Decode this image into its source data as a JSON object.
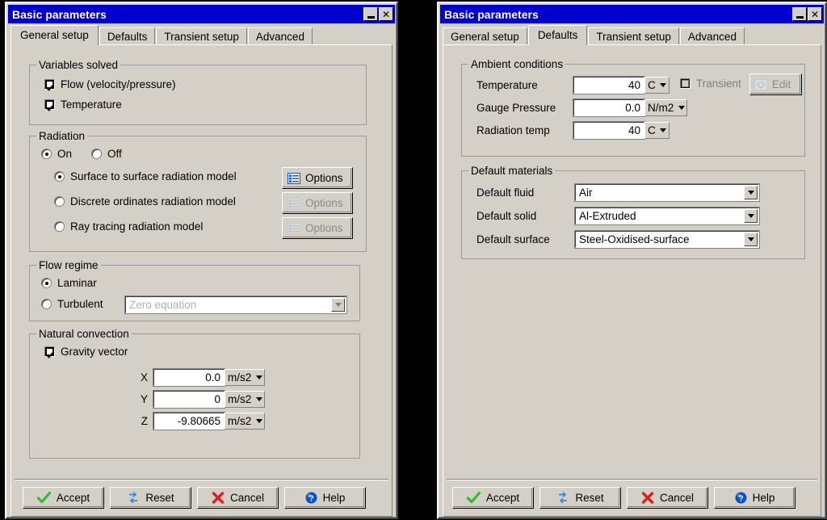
{
  "windows": [
    {
      "title": "Basic parameters",
      "titlebar": {
        "minimize": "minimize-icon",
        "close": "close-icon"
      },
      "tabs": [
        {
          "label": "General setup",
          "active": true
        },
        {
          "label": "Defaults",
          "active": false
        },
        {
          "label": "Transient setup",
          "active": false
        },
        {
          "label": "Advanced",
          "active": false
        }
      ],
      "groups": {
        "variables_solved": {
          "legend": "Variables solved",
          "checks": [
            {
              "label": "Flow (velocity/pressure)",
              "checked": true
            },
            {
              "label": "Temperature",
              "checked": true
            }
          ]
        },
        "radiation": {
          "legend": "Radiation",
          "onoff": [
            {
              "label": "On",
              "selected": true
            },
            {
              "label": "Off",
              "selected": false
            }
          ],
          "models": [
            {
              "label": "Surface to surface radiation model",
              "selected": true,
              "button": "Options",
              "enabled": true
            },
            {
              "label": "Discrete ordinates radiation model",
              "selected": false,
              "button": "Options",
              "enabled": false
            },
            {
              "label": "Ray tracing radiation model",
              "selected": false,
              "button": "Options",
              "enabled": false
            }
          ]
        },
        "flow_regime": {
          "legend": "Flow regime",
          "options": [
            {
              "label": "Laminar",
              "selected": true
            },
            {
              "label": "Turbulent",
              "selected": false
            }
          ],
          "turbulence_model": "Zero equation",
          "turbulence_enabled": false
        },
        "natural_convection": {
          "legend": "Natural convection",
          "gravity_label": "Gravity vector",
          "gravity_checked": true,
          "components": [
            {
              "axis": "X",
              "value": "0.0",
              "unit": "m/s2"
            },
            {
              "axis": "Y",
              "value": "0",
              "unit": "m/s2"
            },
            {
              "axis": "Z",
              "value": "-9.80665",
              "unit": "m/s2"
            }
          ]
        }
      },
      "buttons": [
        {
          "label": "Accept",
          "icon": "check-icon"
        },
        {
          "label": "Reset",
          "icon": "refresh-icon"
        },
        {
          "label": "Cancel",
          "icon": "cross-icon"
        },
        {
          "label": "Help",
          "icon": "question-icon"
        }
      ]
    },
    {
      "title": "Basic parameters",
      "titlebar": {
        "minimize": "minimize-icon",
        "close": "close-icon"
      },
      "tabs": [
        {
          "label": "General setup",
          "active": false
        },
        {
          "label": "Defaults",
          "active": true
        },
        {
          "label": "Transient setup",
          "active": false
        },
        {
          "label": "Advanced",
          "active": false
        }
      ],
      "groups": {
        "ambient_conditions": {
          "legend": "Ambient conditions",
          "rows": [
            {
              "label": "Temperature",
              "value": "40",
              "unit": "C"
            },
            {
              "label": "Gauge Pressure",
              "value": "0.0",
              "unit": "N/m2"
            },
            {
              "label": "Radiation temp",
              "value": "40",
              "unit": "C"
            }
          ],
          "transient_label": "Transient",
          "transient_checked": false,
          "transient_enabled": false,
          "edit_label": "Edit",
          "edit_enabled": false
        },
        "default_materials": {
          "legend": "Default materials",
          "rows": [
            {
              "label": "Default fluid",
              "value": "Air"
            },
            {
              "label": "Default solid",
              "value": "Al-Extruded"
            },
            {
              "label": "Default surface",
              "value": "Steel-Oxidised-surface"
            }
          ]
        }
      },
      "buttons": [
        {
          "label": "Accept",
          "icon": "check-icon"
        },
        {
          "label": "Reset",
          "icon": "refresh-icon"
        },
        {
          "label": "Cancel",
          "icon": "cross-icon"
        },
        {
          "label": "Help",
          "icon": "question-icon"
        }
      ]
    }
  ],
  "colors": {
    "titlebar": "#0000cc",
    "face": "#d4d0c8",
    "field": "#ffffff",
    "disabled_text": "#808080",
    "accept_icon": "#33cc33",
    "cancel_icon": "#dd2222",
    "help_icon": "#0055cc",
    "reset_icon": "#3388dd"
  }
}
